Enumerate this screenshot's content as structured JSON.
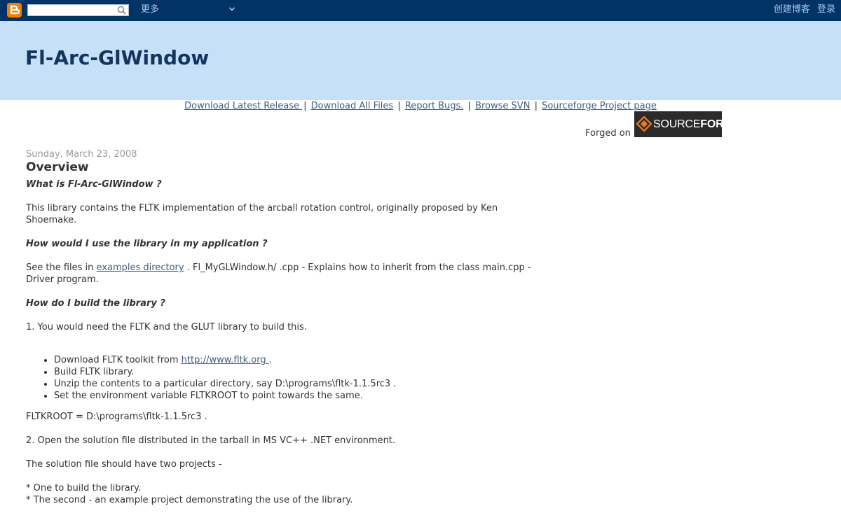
{
  "navbar": {
    "search_placeholder": "",
    "more_label": "更多",
    "create_blog": "创建博客",
    "login": "登录",
    "colors": {
      "bar": "#003366",
      "logo": "#f57d00"
    }
  },
  "blog": {
    "title": "Fl-Arc-GlWindow"
  },
  "toplinks": [
    "Download Latest Release ",
    "Download All Files",
    "Report Bugs.",
    "Browse SVN",
    "Sourceforge Project page"
  ],
  "forged": {
    "text": "Forged on",
    "logo_plain": "SOURCE",
    "logo_bold": "FORGE"
  },
  "post": {
    "date": "Sunday, March 23, 2008",
    "title": "Overview",
    "q1": "What is Fl-Arc-GlWindow ?",
    "a1": "This library contains the FLTK implementation of the arcball rotation control, originally proposed by Ken Shoemake.",
    "q2": "How would I use the library in my application ?",
    "a2_pre": "See the files in ",
    "a2_link": "examples directory",
    "a2_post": " . Fl_MyGLWindow.h/ .cpp - Explains how to inherit from the class main.cpp - Driver program.",
    "q3": "How do I build the library ?",
    "step1": "1. You would need the FLTK and the GLUT library to build this.",
    "bullets": {
      "b1_pre": "Download FLTK toolkit from ",
      "b1_link": "http://www.fltk.org ",
      "b1_post": ".",
      "b2": "Build FLTK library.",
      "b3": "Unzip the contents to a particular directory, say D:\\programs\\fltk-1.1.5rc3 .",
      "b4": "Set the environment variable FLTKROOT to point towards the same."
    },
    "fltkroot": "FLTKROOT = D:\\programs\\fltk-1.1.5rc3 .",
    "step2": "2. Open the solution file distributed in the tarball in MS VC++ .NET environment.",
    "solution": "The solution file should have two projects -",
    "proj1": "* One to build the library.",
    "proj2": "* The second - an example project demonstrating the use of the library."
  }
}
